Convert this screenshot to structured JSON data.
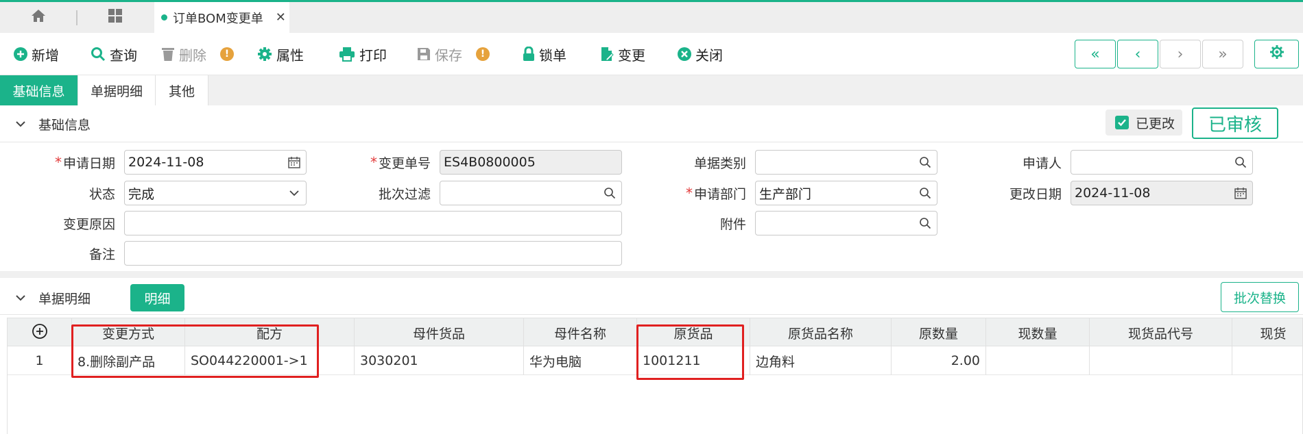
{
  "tabs": {
    "doc_title": "订单BOM变更单",
    "close": "✕"
  },
  "toolbar": {
    "add": "新增",
    "query": "查询",
    "delete": "删除",
    "props": "属性",
    "print": "打印",
    "save": "保存",
    "lock": "锁单",
    "change": "变更",
    "close": "关闭",
    "warn_mark": "!"
  },
  "nav": {
    "first": "«",
    "prev": "‹",
    "next": "›",
    "last": "»"
  },
  "subtabs": [
    "基础信息",
    "单据明细",
    "其他"
  ],
  "basic": {
    "section_title": "基础信息",
    "changed_label": "已更改",
    "approved_label": "已审核",
    "required_mark": "*",
    "fields": {
      "apply_date_label": "申请日期",
      "apply_date": "2024-11-08",
      "change_no_label": "变更单号",
      "change_no": "ES4B0800005",
      "doc_type_label": "单据类别",
      "doc_type": "",
      "applicant_label": "申请人",
      "applicant": "",
      "status_label": "状态",
      "status": "完成",
      "batch_filter_label": "批次过滤",
      "batch_filter": "",
      "dept_label": "申请部门",
      "dept": "生产部门",
      "modify_date_label": "更改日期",
      "modify_date": "2024-11-08",
      "reason_label": "变更原因",
      "reason": "",
      "attach_label": "附件",
      "attach": "",
      "remark_label": "备注",
      "remark": ""
    }
  },
  "detail": {
    "section_title": "单据明细",
    "detail_btn": "明细",
    "batch_replace_btn": "批次替换",
    "columns": [
      "变更方式",
      "配方",
      "母件货品",
      "母件名称",
      "原货品",
      "原货品名称",
      "原数量",
      "现数量",
      "现货品代号",
      "现货"
    ],
    "rows": [
      {
        "no": "1",
        "mode": "8.删除副产品",
        "recipe": "SO044220001->1",
        "parent_item": "3030201",
        "parent_name": "华为电脑",
        "orig_item": "1001211",
        "orig_name": "边角料",
        "orig_qty": "2.00",
        "cur_qty": "",
        "cur_code": "",
        "cur": ""
      }
    ]
  },
  "colors": {
    "accent": "#1bb38a",
    "highlight": "#e02020",
    "warning": "#e6a23c"
  }
}
